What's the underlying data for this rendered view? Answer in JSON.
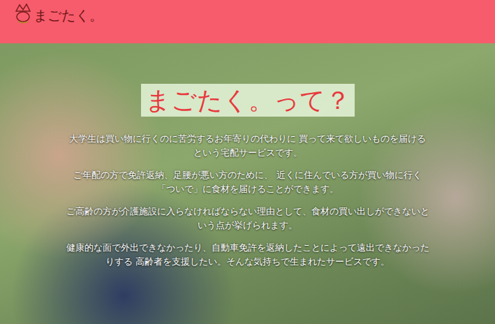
{
  "header": {
    "logo": "まごたく。"
  },
  "hero": {
    "title": "まごたく。って？",
    "paragraphs": [
      "大学生は買い物に行くのに苦労するお年寄りの代わりに 買って来て欲しいものを届けるという宅配サービスです。",
      "ご年配の方で免許返納、足腰が悪い方のために、 近くに住んでいる方が買い物に行く「ついで」に食材を届けることができます。",
      "ご高齢の方が介護施設に入らなければならない理由として、食材の買い出しができないという点が挙げられます。",
      "健康的な面で外出できなかったり、自動車免許を返納したことによって遠出できなかったりする 高齢者を支援したい。そんな気持ちで生まれたサービスです。"
    ]
  }
}
